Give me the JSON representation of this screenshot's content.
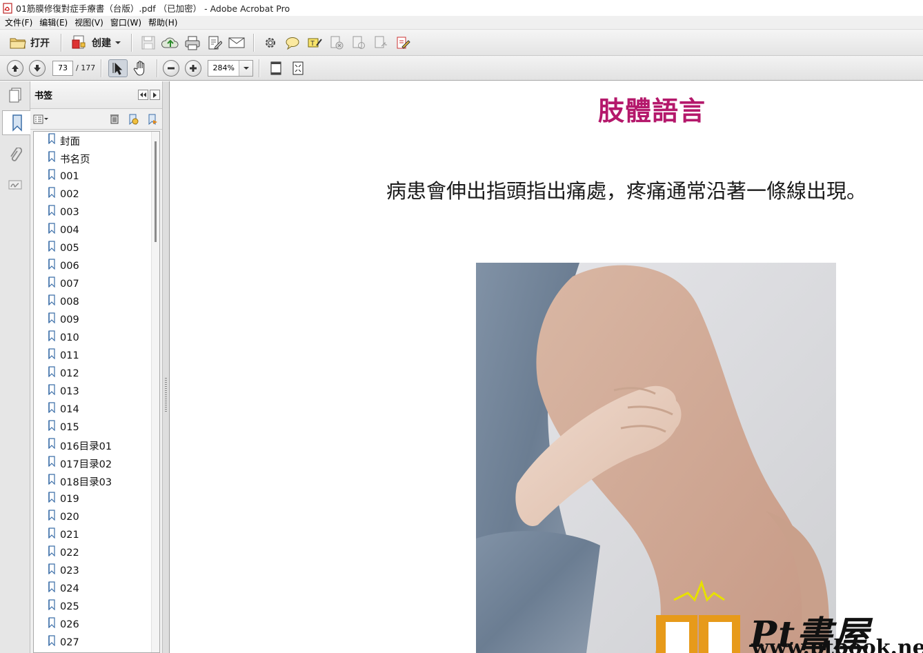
{
  "window": {
    "title": "01筋膜修復對症手療書（台版）.pdf （已加密） - Adobe Acrobat Pro"
  },
  "menu": [
    "文件(F)",
    "编辑(E)",
    "视图(V)",
    "窗口(W)",
    "帮助(H)"
  ],
  "toolbar": {
    "open_label": "打开",
    "create_label": "创建"
  },
  "navigation": {
    "current_page": "73",
    "total_pages": "/ 177",
    "zoom": "284%"
  },
  "bookmarks": {
    "title": "书签",
    "items": [
      "封面",
      "书名页",
      "001",
      "002",
      "003",
      "004",
      "005",
      "006",
      "007",
      "008",
      "009",
      "010",
      "011",
      "012",
      "013",
      "014",
      "015",
      "016目录01",
      "017目录02",
      "018目录03",
      "019",
      "020",
      "021",
      "022",
      "023",
      "024",
      "025",
      "026",
      "027"
    ]
  },
  "document": {
    "heading": "肢體語言",
    "sentence": "病患會伸出指頭指出痛處，疼痛通常沿著一條線出現。",
    "heading_color": "#b4186b",
    "watermark_text": "Pt書屋",
    "watermark_url": "www.ptbook.net"
  }
}
